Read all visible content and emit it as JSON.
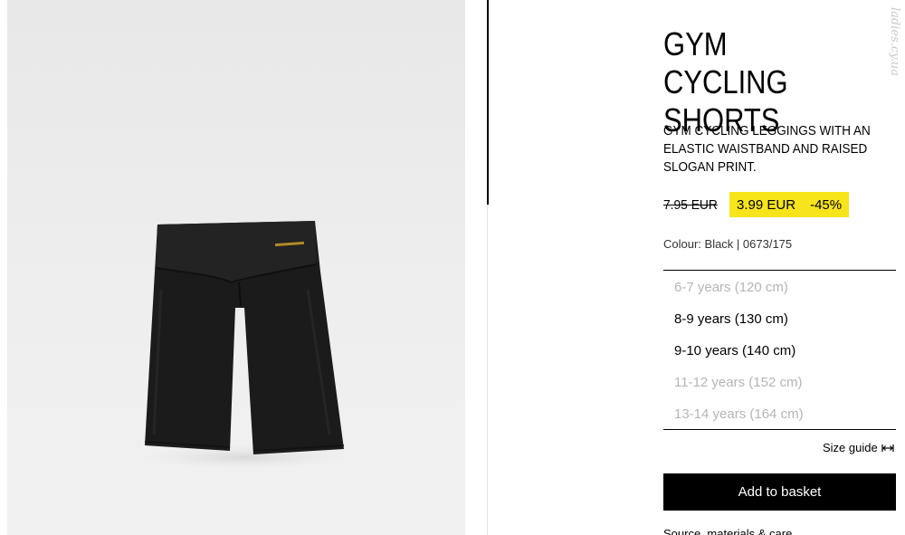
{
  "product": {
    "title": "GYM CYCLING SHORTS",
    "description": "GYM CYCLING LEGGINGS WITH AN ELASTIC WAISTBAND AND RAISED SLOGAN PRINT.",
    "old_price": "7.95 EUR",
    "sale_price": "3.99 EUR",
    "discount": "-45%",
    "colour_info": "Colour: Black | 0673/175"
  },
  "sizes": [
    {
      "label": "6-7 years (120 cm)",
      "available": false
    },
    {
      "label": "8-9 years (130 cm)",
      "available": true
    },
    {
      "label": "9-10 years (140 cm)",
      "available": true
    },
    {
      "label": "11-12 years (152 cm)",
      "available": false
    },
    {
      "label": "13-14 years (164 cm)",
      "available": false
    }
  ],
  "actions": {
    "size_guide_label": "Size guide",
    "add_to_basket_label": "Add to basket"
  },
  "footer": {
    "link_label": "Source, materials & care"
  },
  "colors": {
    "sale_highlight": "#f7e41a",
    "unavailable_text": "#b5b5b5",
    "primary": "#000000"
  },
  "icons": {
    "size_guide": "measure-arrows-icon"
  }
}
